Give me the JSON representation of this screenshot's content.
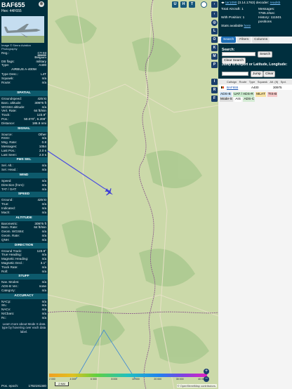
{
  "infoblock": {
    "callsign": "BAF655",
    "hex_label": "Hex:",
    "hex_value": "44F655",
    "photo_credit": "Image © Sierra Aviation Photography",
    "reg_label": "Reg.:",
    "reg_value": "CT-03",
    "country": "Belgium",
    "db_flags_label": "DB flags:",
    "db_flags_value": "military",
    "type_label": "Type:",
    "type_value": "A400",
    "type_full": "AIRBUS A-400M",
    "type_desc_label": "Type Desc.:",
    "type_desc_value": "L4T",
    "squawk_label": "Squawk:",
    "squawk_value": "n/a",
    "route_label": "Route:",
    "route_value": "n/a"
  },
  "spatial": {
    "header": "SPATIAL",
    "rows": [
      {
        "k": "Groundspeed:",
        "v": "425 kt"
      },
      {
        "k": "Baro. altitude:",
        "v": "30975 ft"
      },
      {
        "k": "WGS84 altitude:",
        "v": "n/a"
      },
      {
        "k": "Vert. Rate:",
        "v": "64 ft/min"
      },
      {
        "k": "Track:",
        "v": "123.9°"
      },
      {
        "k": "Pos.:",
        "v": "50.070°, 6.208°"
      },
      {
        "k": "Distance:",
        "v": "186.9 nmi"
      }
    ]
  },
  "signal": {
    "header": "SIGNAL",
    "rows": [
      {
        "k": "Source:",
        "v": "Other"
      },
      {
        "k": "RSSI:",
        "v": "n/a"
      },
      {
        "k": "Msg. Rate:",
        "v": "0.8"
      },
      {
        "k": "Messages:",
        "v": "1054"
      },
      {
        "k": "Last Pos.:",
        "v": "2.0 s"
      },
      {
        "k": "Last Seen:",
        "v": "2.0 s"
      }
    ]
  },
  "fmssel": {
    "header": "FMS SEL",
    "rows": [
      {
        "k": "Sel. Alt.:",
        "v": "n/a"
      },
      {
        "k": "Sel. Head.:",
        "v": "n/a"
      }
    ]
  },
  "wind": {
    "header": "WIND",
    "rows": [
      {
        "k": "Speed:",
        "v": "n/a"
      },
      {
        "k": "Direction (from):",
        "v": "n/a"
      },
      {
        "k": "TAT / OAT:",
        "v": "n/a"
      }
    ]
  },
  "speed": {
    "header": "SPEED",
    "rows": [
      {
        "k": "Ground:",
        "v": "425 kt"
      },
      {
        "k": "True:",
        "v": "n/a"
      },
      {
        "k": "Indicated:",
        "v": "n/a"
      },
      {
        "k": "Mach:",
        "v": "n/a"
      }
    ]
  },
  "altitude": {
    "header": "ALTITUDE",
    "rows": [
      {
        "k": "Barometric:",
        "v": "30975 ft"
      },
      {
        "k": "Baro. Rate:",
        "v": "64 ft/min"
      },
      {
        "k": "Geom. WGS84:",
        "v": "n/a"
      },
      {
        "k": "Geom. Rate:",
        "v": "n/a"
      },
      {
        "k": "QNH:",
        "v": "n/a"
      }
    ]
  },
  "direction": {
    "header": "DIRECTION",
    "rows": [
      {
        "k": "Ground Track:",
        "v": "123.9°"
      },
      {
        "k": "True Heading:",
        "v": "n/a"
      },
      {
        "k": "Magnetic Heading:",
        "v": "n/a"
      },
      {
        "k": "Magnetic Decl.:",
        "v": "3.1°"
      },
      {
        "k": "Track Rate:",
        "v": "n/a"
      },
      {
        "k": "Roll:",
        "v": "n/a"
      }
    ]
  },
  "stuff": {
    "header": "STUFF",
    "rows": [
      {
        "k": "Nav. Modes:",
        "v": "n/a"
      },
      {
        "k": "ADS-B Ver.:",
        "v": "none"
      },
      {
        "k": "Category:",
        "v": "n/a"
      }
    ]
  },
  "accuracy": {
    "header": "ACCURACY",
    "rows": [
      {
        "k": "NACp:",
        "v": "n/a"
      },
      {
        "k": "SIL:",
        "v": "n/a"
      },
      {
        "k": "NACv:",
        "v": "n/a"
      },
      {
        "k": "NICbaro:",
        "v": "n/a"
      },
      {
        "k": "Rc:",
        "v": "n/a"
      }
    ],
    "learn_more": "Learn more about Mode S data type by hovering over each data label.",
    "pos_epoch_label": "Pos. epoch:",
    "pos_epoch_value": "1762191340"
  },
  "map": {
    "top_buttons": [
      "U",
      "H",
      "T"
    ],
    "side_buttons": [
      "L",
      "O",
      "K",
      "M",
      "P",
      "I",
      "R",
      "F"
    ],
    "scale_label": "2 NM",
    "attribution": "© OpenStreetMap contributors.",
    "altitude_ticks": [
      "2 000",
      "4 000",
      "6 000",
      "8 000",
      "10 000",
      "20 000",
      "30 000",
      "40 000+"
    ],
    "zoom_in": "+",
    "zoom_out": "−"
  },
  "sidebar": {
    "version_link": "tar1090",
    "version_rest": " (3.14.1763) decoder: ",
    "readsb": "readsb",
    "total_aircraft_label": "Total Aircraft:",
    "total_aircraft_value": "1",
    "messages_label": "Messages:",
    "messages_value": "7765.2/sec",
    "with_position_label": "With Position:",
    "with_position_value": "1",
    "history_label": "History:",
    "history_value": "111501 positions",
    "stats_label": "Stats available",
    "stats_link": "here",
    "tabs": [
      "Search",
      "Filters",
      "Columns"
    ],
    "search_label": "Search:",
    "search_button": "Search",
    "clear_search": "Clear Search",
    "jump_label": "Jump to Airport or Latitude, Longitude:",
    "jump_button": "Jump",
    "clear_button": "Clear",
    "columns": [
      "Callsign",
      "Route",
      "Type",
      "Squawk",
      "Alt. (ft)",
      "Spd."
    ],
    "row": {
      "callsign": "BAF655",
      "type": "A400",
      "alt": "30975"
    },
    "legend": [
      "ADS-B",
      "UAT / ADS-R",
      "MLAT",
      "TIS-B",
      "Mode-S",
      "AIS",
      "ADS-C"
    ]
  },
  "colors": {
    "panel": "#002f3e",
    "section": "#0d5a6c",
    "map": "#c9d9a7",
    "track": "#4a4de0"
  }
}
